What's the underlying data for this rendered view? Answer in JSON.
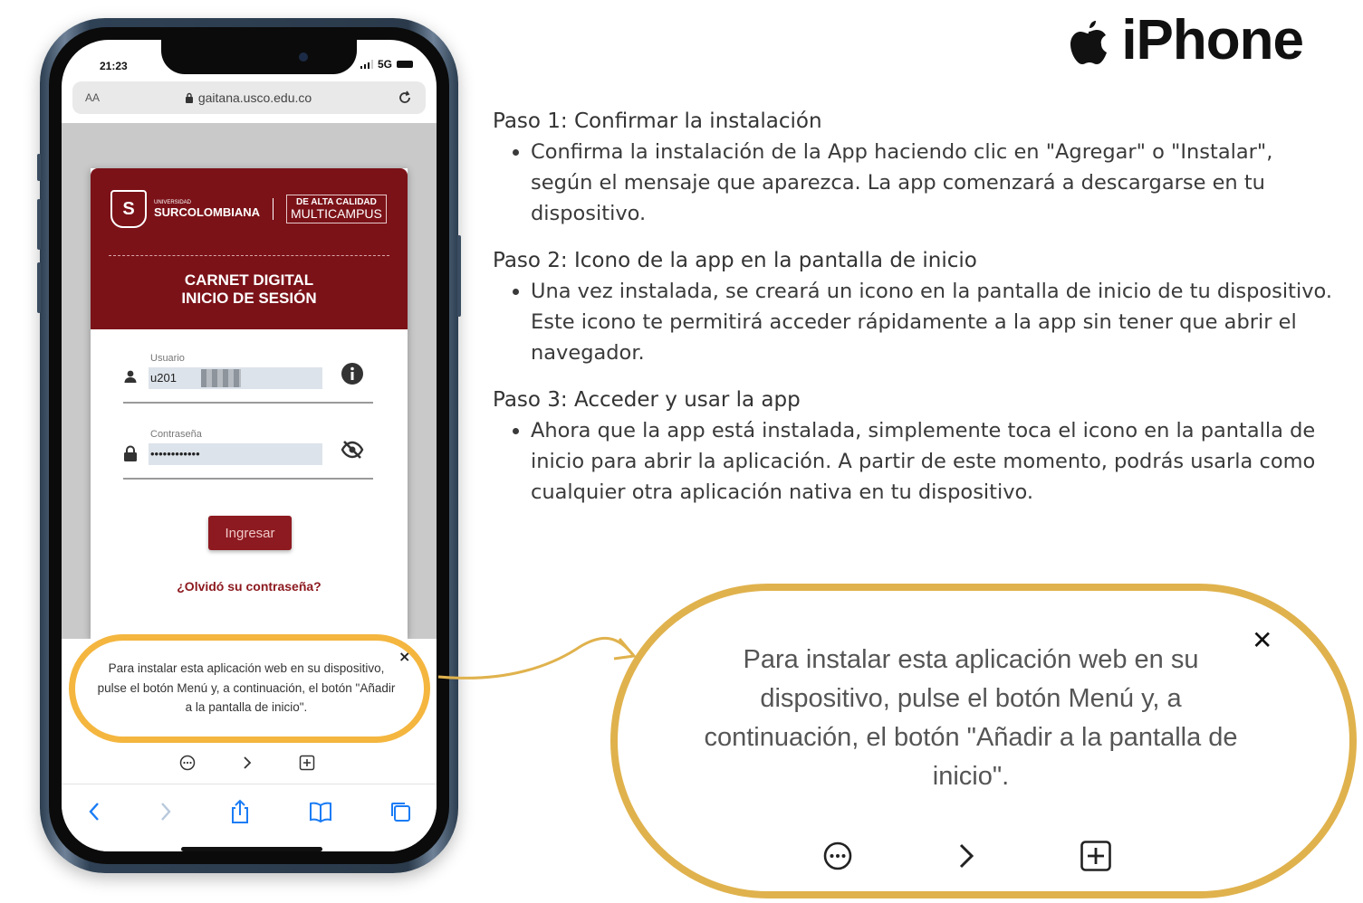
{
  "brand": {
    "name": "iPhone",
    "icon": "apple-logo-icon"
  },
  "steps": [
    {
      "title": "Paso 1: Confirmar la instalación",
      "body": "Confirma la instalación de la App haciendo clic en \"Agregar\" o \"Instalar\", según el mensaje que aparezca. La app comenzará a descargarse en tu dispositivo."
    },
    {
      "title": "Paso 2: Icono de la app en la pantalla de inicio",
      "body": "Una vez instalada, se creará un icono en la pantalla de inicio de tu dispositivo. Este icono te permitirá acceder rápidamente a la app sin tener que abrir el navegador."
    },
    {
      "title": "Paso 3: Acceder y usar la app",
      "body": "Ahora que la app está instalada, simplemente toca el icono en la pantalla de inicio para abrir la aplicación. A partir de este momento, podrás usarla como cualquier otra aplicación nativa en tu dispositivo."
    }
  ],
  "phone": {
    "time": "21:23",
    "network": "5G",
    "url_prefix": "AA",
    "url": "gaitana.usco.edu.co",
    "university_small": "UNIVERSIDAD",
    "university": "SURCOLOMBIANA",
    "accreditation_line1": "DE ALTA CALIDAD",
    "accreditation_line2": "MULTICAMPUS",
    "card_title_line1": "CARNET DIGITAL",
    "card_title_line2": "INICIO DE SESIÓN",
    "username_label": "Usuario",
    "username_value": "u201",
    "password_label": "Contraseña",
    "password_value": "••••••••••••",
    "login_button": "Ingresar",
    "forgot_link": "¿Olvidó su contraseña?",
    "popup_message": "Para instalar esta aplicación web en su dispositivo, pulse el botón Menú y, a continuación, el botón \"Añadir a la pantalla de inicio\".",
    "popup_close": "×"
  },
  "zoom": {
    "message": "Para instalar esta aplicación web en su dispositivo, pulse el botón Menú y, a continuación, el botón \"Añadir a la pantalla de inicio\".",
    "close": "✕"
  },
  "colors": {
    "usco_red": "#7b1218",
    "highlight_orange": "#f4b63f",
    "bubble_gold": "#e0b24d",
    "safari_blue": "#1a7cf5"
  }
}
